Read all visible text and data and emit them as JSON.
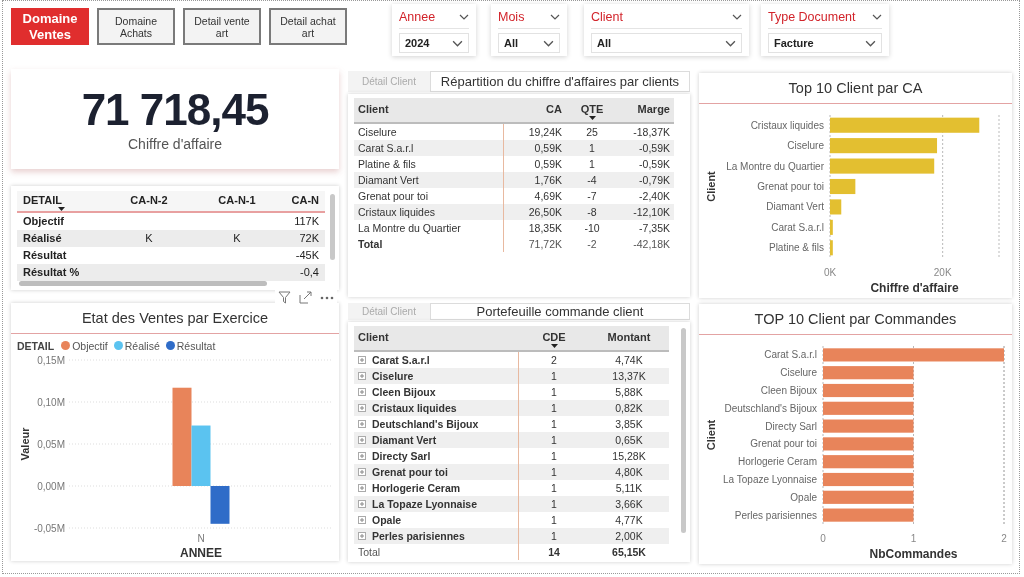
{
  "nav_buttons": [
    {
      "label": "Domaine Ventes",
      "selected": true
    },
    {
      "label": "Domaine Achats",
      "selected": false
    },
    {
      "label": "Detail vente art",
      "selected": false
    },
    {
      "label": "Detail achat art",
      "selected": false
    }
  ],
  "filters": [
    {
      "label": "Annee",
      "value": "2024"
    },
    {
      "label": "Mois",
      "value": "All"
    },
    {
      "label": "Client",
      "value": "All"
    },
    {
      "label": "Type Document",
      "value": "Facture"
    }
  ],
  "kpi_card": {
    "value": "71 718,45",
    "label": "Chiffre d'affaire"
  },
  "revenue_table": {
    "tab": {
      "label": "Détail Client",
      "selected": false
    },
    "title": "Répartition du chiffre d'affaires par clients",
    "columns": [
      {
        "label": "Client",
        "sorted": false
      },
      {
        "label": "CA",
        "sorted": false
      },
      {
        "label": "QTE",
        "sorted": true
      },
      {
        "label": "Marge",
        "sorted": false
      }
    ],
    "rows": [
      {
        "cells": [
          "Ciselure",
          "19,24K",
          "25",
          "-18,37K"
        ]
      },
      {
        "cells": [
          "Carat S.a.r.l",
          "0,59K",
          "1",
          "-0,59K"
        ]
      },
      {
        "cells": [
          "Platine & fils",
          "0,59K",
          "1",
          "-0,59K"
        ]
      },
      {
        "cells": [
          "Diamant Vert",
          "1,76K",
          "-4",
          "-0,79K"
        ]
      },
      {
        "cells": [
          "Grenat pour toi",
          "4,69K",
          "-7",
          "-2,40K"
        ]
      },
      {
        "cells": [
          "Cristaux liquides",
          "26,50K",
          "-8",
          "-12,10K"
        ]
      },
      {
        "cells": [
          "La Montre du Quartier",
          "18,35K",
          "-10",
          "-7,35K"
        ]
      }
    ],
    "total": [
      "Total",
      "71,72K",
      "-2",
      "-42,18K"
    ]
  },
  "top_clients_by_revenue": {
    "title": "Top 10 Client par CA",
    "chart_data": {
      "type": "bar",
      "orientation": "horizontal",
      "xlabel": "Chiffre d'affaire",
      "ylabel": "Client",
      "categories": [
        "Cristaux liquides",
        "Ciselure",
        "La Montre du Quartier",
        "Grenat pour toi",
        "Diamant Vert",
        "Carat S.a.r.l",
        "Platine & fils"
      ],
      "series": [
        {
          "color": "#e3bf30",
          "values": [
            26500,
            19000,
            18500,
            4500,
            2000,
            500,
            500
          ]
        }
      ],
      "grid": true,
      "xlim": [
        0,
        30000
      ],
      "xticks": [
        {
          "value": 0,
          "label": "0K"
        },
        {
          "value": 20000,
          "label": "20K"
        }
      ]
    }
  },
  "detail_matrix": {
    "columns": [
      {
        "label": "DETAIL",
        "sorted": true
      },
      {
        "label": "CA-N-2",
        "sorted": false
      },
      {
        "label": "CA-N-1",
        "sorted": false
      },
      {
        "label": "CA-N",
        "sorted": false
      }
    ],
    "rows": [
      {
        "cells": [
          "Objectif",
          null,
          null,
          "117K"
        ]
      },
      {
        "cells": [
          "Réalisé",
          "K",
          "K",
          "72K"
        ]
      },
      {
        "cells": [
          "Résultat",
          null,
          null,
          "-45K"
        ]
      },
      {
        "cells": [
          "Résultat %",
          null,
          null,
          "-0,4"
        ]
      }
    ]
  },
  "sales_by_year": {
    "title": "Etat des Ventes par Exercice",
    "legend_title": "DETAIL",
    "chart_data": {
      "type": "bar",
      "xlabel": "ANNEE",
      "ylabel": "Valeur",
      "categories": [
        "N"
      ],
      "series": [
        {
          "name": "Objectif",
          "color": "#e8845a",
          "values": [
            117000
          ]
        },
        {
          "name": "Réalisé",
          "color": "#5bc3f0",
          "values": [
            72000
          ]
        },
        {
          "name": "Résultat",
          "color": "#2f6cc8",
          "values": [
            -45000
          ]
        }
      ],
      "grid": true,
      "ylim": [
        -50000,
        150000
      ],
      "yticks": [
        {
          "value": -50000,
          "label": "-0,05M"
        },
        {
          "value": 0,
          "label": "0,00M"
        },
        {
          "value": 50000,
          "label": "0,05M"
        },
        {
          "value": 100000,
          "label": "0,10M"
        },
        {
          "value": 150000,
          "label": "0,15M"
        }
      ]
    }
  },
  "orders_table": {
    "tab": {
      "label": "Détail Client",
      "selected": false
    },
    "title": "Portefeuille commande client",
    "columns": [
      {
        "label": "Client",
        "sorted": false
      },
      {
        "label": "CDE",
        "sorted": true
      },
      {
        "label": "Montant",
        "sorted": false
      }
    ],
    "rows": [
      {
        "expanded": false,
        "cells": [
          "Carat S.a.r.l",
          "2",
          "4,74K"
        ]
      },
      {
        "expanded": false,
        "cells": [
          "Ciselure",
          "1",
          "13,37K"
        ]
      },
      {
        "expanded": false,
        "cells": [
          "Cleen Bijoux",
          "1",
          "5,88K"
        ]
      },
      {
        "expanded": false,
        "cells": [
          "Cristaux liquides",
          "1",
          "0,82K"
        ]
      },
      {
        "expanded": false,
        "cells": [
          "Deutschland's Bijoux",
          "1",
          "3,85K"
        ]
      },
      {
        "expanded": false,
        "cells": [
          "Diamant Vert",
          "1",
          "0,65K"
        ]
      },
      {
        "expanded": false,
        "cells": [
          "Directy Sarl",
          "1",
          "15,28K"
        ]
      },
      {
        "expanded": false,
        "cells": [
          "Grenat pour toi",
          "1",
          "4,80K"
        ]
      },
      {
        "expanded": false,
        "cells": [
          "Horlogerie Ceram",
          "1",
          "5,11K"
        ]
      },
      {
        "expanded": false,
        "cells": [
          "La Topaze Lyonnaise",
          "1",
          "3,66K"
        ]
      },
      {
        "expanded": false,
        "cells": [
          "Opale",
          "1",
          "4,77K"
        ]
      },
      {
        "expanded": false,
        "cells": [
          "Perles parisiennes",
          "1",
          "2,00K"
        ]
      }
    ],
    "total": [
      "Total",
      "14",
      "65,15K"
    ]
  },
  "top_clients_by_orders": {
    "title": "TOP 10 Client par Commandes",
    "chart_data": {
      "type": "bar",
      "orientation": "horizontal",
      "xlabel": "NbCommandes",
      "ylabel": "Client",
      "categories": [
        "Carat S.a.r.l",
        "Ciselure",
        "Cleen Bijoux",
        "Deutschland's Bijoux",
        "Directy Sarl",
        "Grenat pour toi",
        "Horlogerie Ceram",
        "La Topaze Lyonnaise",
        "Opale",
        "Perles parisiennes"
      ],
      "series": [
        {
          "color": "#e8845a",
          "values": [
            2,
            1,
            1,
            1,
            1,
            1,
            1,
            1,
            1,
            1
          ]
        }
      ],
      "grid": true,
      "xlim": [
        0,
        2
      ],
      "xticks": [
        0,
        1,
        2
      ]
    }
  }
}
